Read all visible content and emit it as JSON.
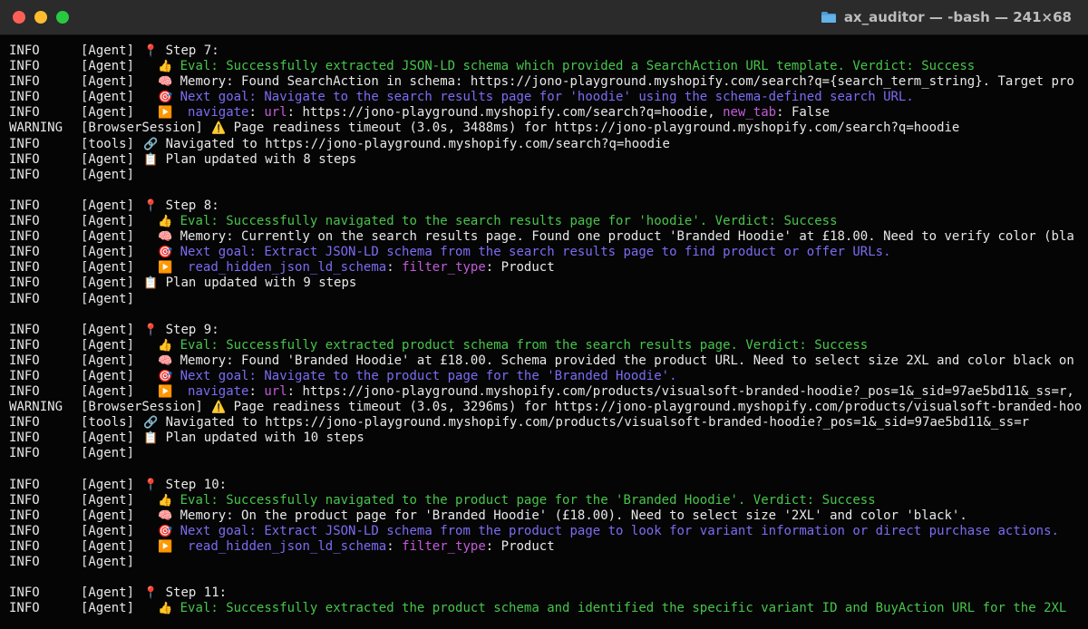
{
  "window": {
    "title": "ax_auditor — -bash — 241×68",
    "icons": {
      "close": "close-light",
      "minimize": "minimize-light",
      "zoom": "zoom-light",
      "folder": "folder-icon"
    },
    "colors": {
      "green": "#47c54b",
      "blue": "#7b6cf3",
      "purple": "#c25cd8",
      "text": "#e8e8e8"
    }
  },
  "lines": [
    {
      "level": "INFO",
      "source": "[Agent]",
      "indent": 0,
      "icon": "📍",
      "parts": [
        {
          "text": "Step 7:",
          "cls": "t-white"
        }
      ]
    },
    {
      "level": "INFO",
      "source": "[Agent]",
      "indent": 1,
      "icon": "👍",
      "parts": [
        {
          "text": "Eval: Successfully extracted JSON-LD schema which provided a SearchAction URL template. Verdict: Success",
          "cls": "t-green"
        }
      ]
    },
    {
      "level": "INFO",
      "source": "[Agent]",
      "indent": 1,
      "icon": "🧠",
      "parts": [
        {
          "text": "Memory: Found SearchAction in schema: https://jono-playground.myshopify.com/search?q={search_term_string}. Target pro",
          "cls": "t-white"
        }
      ]
    },
    {
      "level": "INFO",
      "source": "[Agent]",
      "indent": 1,
      "icon": "🎯",
      "parts": [
        {
          "text": "Next goal: Navigate to the search results page for 'hoodie' using the schema-defined search URL.",
          "cls": "t-blue"
        }
      ]
    },
    {
      "level": "INFO",
      "source": "[Agent]",
      "indent": 1,
      "icon": "▶️",
      "parts": [
        {
          "text": " navigate",
          "cls": "t-blue"
        },
        {
          "text": ": ",
          "cls": "t-white"
        },
        {
          "text": "url",
          "cls": "t-purple"
        },
        {
          "text": ": https://jono-playground.myshopify.com/search?q=hoodie, ",
          "cls": "t-white"
        },
        {
          "text": "new_tab",
          "cls": "t-purple"
        },
        {
          "text": ": False",
          "cls": "t-white"
        }
      ]
    },
    {
      "level": "WARNING",
      "source": "[BrowserSession]",
      "indent": -1,
      "icon": "⚠️",
      "parts": [
        {
          "text": "Page readiness timeout (3.0s, 3488ms) for https://jono-playground.myshopify.com/search?q=hoodie",
          "cls": "t-white"
        }
      ]
    },
    {
      "level": "INFO",
      "source": "[tools]",
      "indent": -2,
      "icon": "🔗",
      "parts": [
        {
          "text": "Navigated to https://jono-playground.myshopify.com/search?q=hoodie",
          "cls": "t-white"
        }
      ]
    },
    {
      "level": "INFO",
      "source": "[Agent]",
      "indent": 0,
      "icon": "📋",
      "parts": [
        {
          "text": "Plan updated with 8 steps",
          "cls": "t-white"
        }
      ]
    },
    {
      "level": "INFO",
      "source": "[Agent]",
      "indent": 0,
      "icon": "",
      "parts": []
    },
    {
      "level": "",
      "source": "",
      "indent": 0,
      "icon": "",
      "parts": []
    },
    {
      "level": "INFO",
      "source": "[Agent]",
      "indent": 0,
      "icon": "📍",
      "parts": [
        {
          "text": "Step 8:",
          "cls": "t-white"
        }
      ]
    },
    {
      "level": "INFO",
      "source": "[Agent]",
      "indent": 1,
      "icon": "👍",
      "parts": [
        {
          "text": "Eval: Successfully navigated to the search results page for 'hoodie'. Verdict: Success",
          "cls": "t-green"
        }
      ]
    },
    {
      "level": "INFO",
      "source": "[Agent]",
      "indent": 1,
      "icon": "🧠",
      "parts": [
        {
          "text": "Memory: Currently on the search results page. Found one product 'Branded Hoodie' at £18.00. Need to verify color (bla",
          "cls": "t-white"
        }
      ]
    },
    {
      "level": "INFO",
      "source": "[Agent]",
      "indent": 1,
      "icon": "🎯",
      "parts": [
        {
          "text": "Next goal: Extract JSON-LD schema from the search results page to find product or offer URLs.",
          "cls": "t-blue"
        }
      ]
    },
    {
      "level": "INFO",
      "source": "[Agent]",
      "indent": 1,
      "icon": "▶️",
      "parts": [
        {
          "text": " read_hidden_json_ld_schema",
          "cls": "t-blue"
        },
        {
          "text": ": ",
          "cls": "t-white"
        },
        {
          "text": "filter_type",
          "cls": "t-purple"
        },
        {
          "text": ": Product",
          "cls": "t-white"
        }
      ]
    },
    {
      "level": "INFO",
      "source": "[Agent]",
      "indent": 0,
      "icon": "📋",
      "parts": [
        {
          "text": "Plan updated with 9 steps",
          "cls": "t-white"
        }
      ]
    },
    {
      "level": "INFO",
      "source": "[Agent]",
      "indent": 0,
      "icon": "",
      "parts": []
    },
    {
      "level": "",
      "source": "",
      "indent": 0,
      "icon": "",
      "parts": []
    },
    {
      "level": "INFO",
      "source": "[Agent]",
      "indent": 0,
      "icon": "📍",
      "parts": [
        {
          "text": "Step 9:",
          "cls": "t-white"
        }
      ]
    },
    {
      "level": "INFO",
      "source": "[Agent]",
      "indent": 1,
      "icon": "👍",
      "parts": [
        {
          "text": "Eval: Successfully extracted product schema from the search results page. Verdict: Success",
          "cls": "t-green"
        }
      ]
    },
    {
      "level": "INFO",
      "source": "[Agent]",
      "indent": 1,
      "icon": "🧠",
      "parts": [
        {
          "text": "Memory: Found 'Branded Hoodie' at £18.00. Schema provided the product URL. Need to select size 2XL and color black on",
          "cls": "t-white"
        }
      ]
    },
    {
      "level": "INFO",
      "source": "[Agent]",
      "indent": 1,
      "icon": "🎯",
      "parts": [
        {
          "text": "Next goal: Navigate to the product page for the 'Branded Hoodie'.",
          "cls": "t-blue"
        }
      ]
    },
    {
      "level": "INFO",
      "source": "[Agent]",
      "indent": 1,
      "icon": "▶️",
      "parts": [
        {
          "text": " navigate",
          "cls": "t-blue"
        },
        {
          "text": ": ",
          "cls": "t-white"
        },
        {
          "text": "url",
          "cls": "t-purple"
        },
        {
          "text": ": https://jono-playground.myshopify.com/products/visualsoft-branded-hoodie?_pos=1&_sid=97ae5bd11&_ss=r,",
          "cls": "t-white"
        }
      ]
    },
    {
      "level": "WARNING",
      "source": "[BrowserSession]",
      "indent": -1,
      "icon": "⚠️",
      "parts": [
        {
          "text": "Page readiness timeout (3.0s, 3296ms) for https://jono-playground.myshopify.com/products/visualsoft-branded-hoo",
          "cls": "t-white"
        }
      ]
    },
    {
      "level": "INFO",
      "source": "[tools]",
      "indent": -2,
      "icon": "🔗",
      "parts": [
        {
          "text": "Navigated to https://jono-playground.myshopify.com/products/visualsoft-branded-hoodie?_pos=1&_sid=97ae5bd11&_ss=r",
          "cls": "t-white"
        }
      ]
    },
    {
      "level": "INFO",
      "source": "[Agent]",
      "indent": 0,
      "icon": "📋",
      "parts": [
        {
          "text": "Plan updated with 10 steps",
          "cls": "t-white"
        }
      ]
    },
    {
      "level": "INFO",
      "source": "[Agent]",
      "indent": 0,
      "icon": "",
      "parts": []
    },
    {
      "level": "",
      "source": "",
      "indent": 0,
      "icon": "",
      "parts": []
    },
    {
      "level": "INFO",
      "source": "[Agent]",
      "indent": 0,
      "icon": "📍",
      "parts": [
        {
          "text": "Step 10:",
          "cls": "t-white"
        }
      ]
    },
    {
      "level": "INFO",
      "source": "[Agent]",
      "indent": 1,
      "icon": "👍",
      "parts": [
        {
          "text": "Eval: Successfully navigated to the product page for the 'Branded Hoodie'. Verdict: Success",
          "cls": "t-green"
        }
      ]
    },
    {
      "level": "INFO",
      "source": "[Agent]",
      "indent": 1,
      "icon": "🧠",
      "parts": [
        {
          "text": "Memory: On the product page for 'Branded Hoodie' (£18.00). Need to select size '2XL' and color 'black'.",
          "cls": "t-white"
        }
      ]
    },
    {
      "level": "INFO",
      "source": "[Agent]",
      "indent": 1,
      "icon": "🎯",
      "parts": [
        {
          "text": "Next goal: Extract JSON-LD schema from the product page to look for variant information or direct purchase actions.",
          "cls": "t-blue"
        }
      ]
    },
    {
      "level": "INFO",
      "source": "[Agent]",
      "indent": 1,
      "icon": "▶️",
      "parts": [
        {
          "text": " read_hidden_json_ld_schema",
          "cls": "t-blue"
        },
        {
          "text": ": ",
          "cls": "t-white"
        },
        {
          "text": "filter_type",
          "cls": "t-purple"
        },
        {
          "text": ": Product",
          "cls": "t-white"
        }
      ]
    },
    {
      "level": "INFO",
      "source": "[Agent]",
      "indent": 0,
      "icon": "",
      "parts": []
    },
    {
      "level": "",
      "source": "",
      "indent": 0,
      "icon": "",
      "parts": []
    },
    {
      "level": "INFO",
      "source": "[Agent]",
      "indent": 0,
      "icon": "📍",
      "parts": [
        {
          "text": "Step 11:",
          "cls": "t-white"
        }
      ]
    },
    {
      "level": "INFO",
      "source": "[Agent]",
      "indent": 1,
      "icon": "👍",
      "parts": [
        {
          "text": "Eval: Successfully extracted the product schema and identified the specific variant ID and BuyAction URL for the 2XL",
          "cls": "t-green"
        }
      ]
    }
  ]
}
